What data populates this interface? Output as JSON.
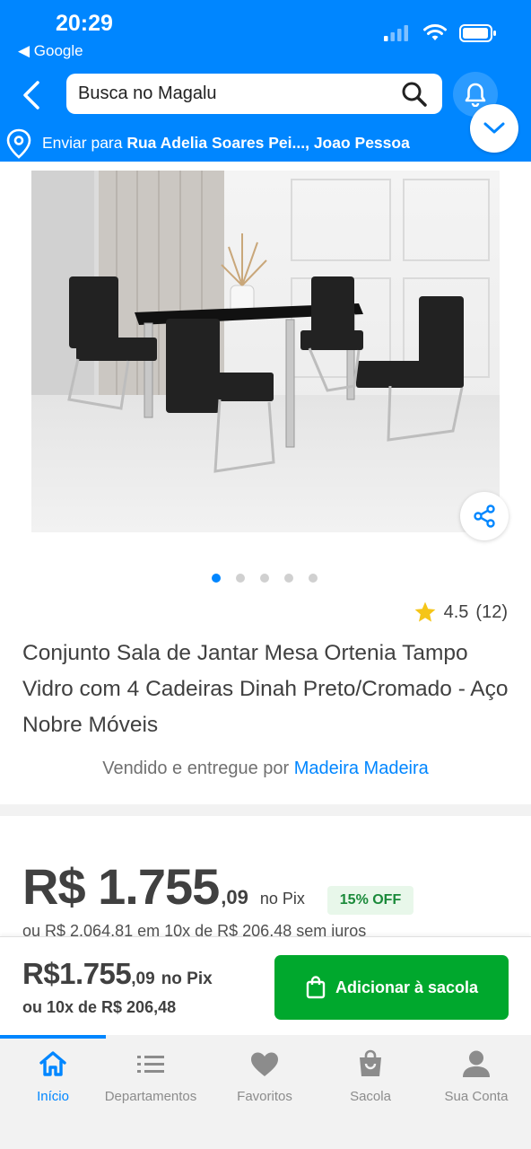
{
  "status_bar": {
    "time": "20:29",
    "back_app": "◀ Google"
  },
  "header": {
    "search_placeholder": "Busca no Magalu",
    "delivery_prefix": "Enviar para ",
    "delivery_address": "Rua Adelia Soares Pei..., Joao Pessoa"
  },
  "gallery": {
    "image_count": 5,
    "active_index": 0
  },
  "product": {
    "rating": "4.5",
    "rating_count": "(12)",
    "title": "Conjunto Sala de Jantar Mesa Ortenia Tampo Vidro com 4 Cadeiras Dinah Preto/Cromado - Aço Nobre Móveis",
    "seller_prefix": "Vendido e entregue por ",
    "seller_name": "Madeira Madeira"
  },
  "price": {
    "main": "R$ 1.755",
    "cents": ",09",
    "pix": "no Pix",
    "discount": "15% OFF",
    "installments": "ou R$ 2.064,81 em 10x de R$ 206,48 sem juros"
  },
  "bottom_bar": {
    "price_main": "R$1.755",
    "price_cents": ",09",
    "pix": "no Pix",
    "installments": "ou 10x de R$ 206,48",
    "add_button": "Adicionar à sacola"
  },
  "tabs": [
    {
      "label": "Início",
      "icon": "home-icon",
      "active": true
    },
    {
      "label": "Departamentos",
      "icon": "list-icon",
      "active": false
    },
    {
      "label": "Favoritos",
      "icon": "heart-icon",
      "active": false
    },
    {
      "label": "Sacola",
      "icon": "bag-icon",
      "active": false
    },
    {
      "label": "Sua Conta",
      "icon": "user-icon",
      "active": false
    }
  ],
  "colors": {
    "brand": "#0086ff",
    "buy_button": "#00a82d",
    "star": "#f5c518"
  }
}
